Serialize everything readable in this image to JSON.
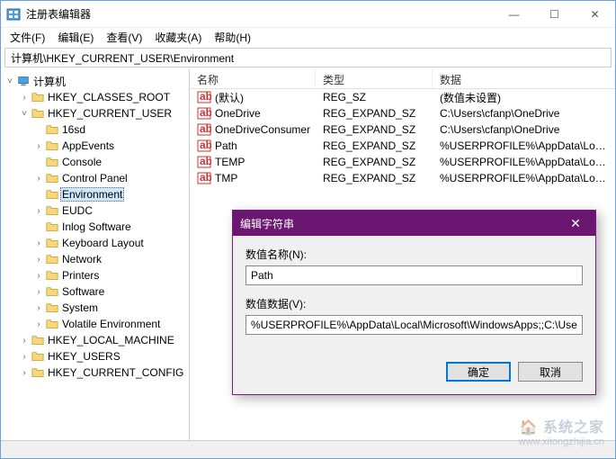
{
  "window": {
    "title": "注册表编辑器",
    "min": "—",
    "max": "☐",
    "close": "✕"
  },
  "menu": {
    "file": "文件(F)",
    "edit": "编辑(E)",
    "view": "查看(V)",
    "favorites": "收藏夹(A)",
    "help": "帮助(H)"
  },
  "address": "计算机\\HKEY_CURRENT_USER\\Environment",
  "tree": {
    "root": "计算机",
    "hkcr": "HKEY_CLASSES_ROOT",
    "hkcu": "HKEY_CURRENT_USER",
    "hklm": "HKEY_LOCAL_MACHINE",
    "hku": "HKEY_USERS",
    "hkcc": "HKEY_CURRENT_CONFIG",
    "hkcu_children": {
      "c0": "16sd",
      "c1": "AppEvents",
      "c2": "Console",
      "c3": "Control Panel",
      "c4": "Environment",
      "c5": "EUDC",
      "c6": "Inlog Software",
      "c7": "Keyboard Layout",
      "c8": "Network",
      "c9": "Printers",
      "c10": "Software",
      "c11": "System",
      "c12": "Volatile Environment"
    }
  },
  "columns": {
    "name": "名称",
    "type": "类型",
    "data": "数据"
  },
  "values": [
    {
      "name": "(默认)",
      "type": "REG_SZ",
      "data": "(数值未设置)",
      "icon": "sz"
    },
    {
      "name": "OneDrive",
      "type": "REG_EXPAND_SZ",
      "data": "C:\\Users\\cfanp\\OneDrive",
      "icon": "sz"
    },
    {
      "name": "OneDriveConsumer",
      "type": "REG_EXPAND_SZ",
      "data": "C:\\Users\\cfanp\\OneDrive",
      "icon": "sz"
    },
    {
      "name": "Path",
      "type": "REG_EXPAND_SZ",
      "data": "%USERPROFILE%\\AppData\\Local\\Microsoft\\...",
      "icon": "sz"
    },
    {
      "name": "TEMP",
      "type": "REG_EXPAND_SZ",
      "data": "%USERPROFILE%\\AppData\\Local\\Temp",
      "icon": "sz"
    },
    {
      "name": "TMP",
      "type": "REG_EXPAND_SZ",
      "data": "%USERPROFILE%\\AppData\\Local\\Temp",
      "icon": "sz"
    }
  ],
  "dialog": {
    "title": "编辑字符串",
    "name_label": "数值名称(N):",
    "name_value": "Path",
    "data_label": "数值数据(V):",
    "data_value": "%USERPROFILE%\\AppData\\Local\\Microsoft\\WindowsApps;;C:\\Users\\cf:",
    "ok": "确定",
    "cancel": "取消",
    "close": "✕"
  },
  "watermark": {
    "top": "🏠 系统之家",
    "bottom": "www.xitongzhijia.cn"
  }
}
